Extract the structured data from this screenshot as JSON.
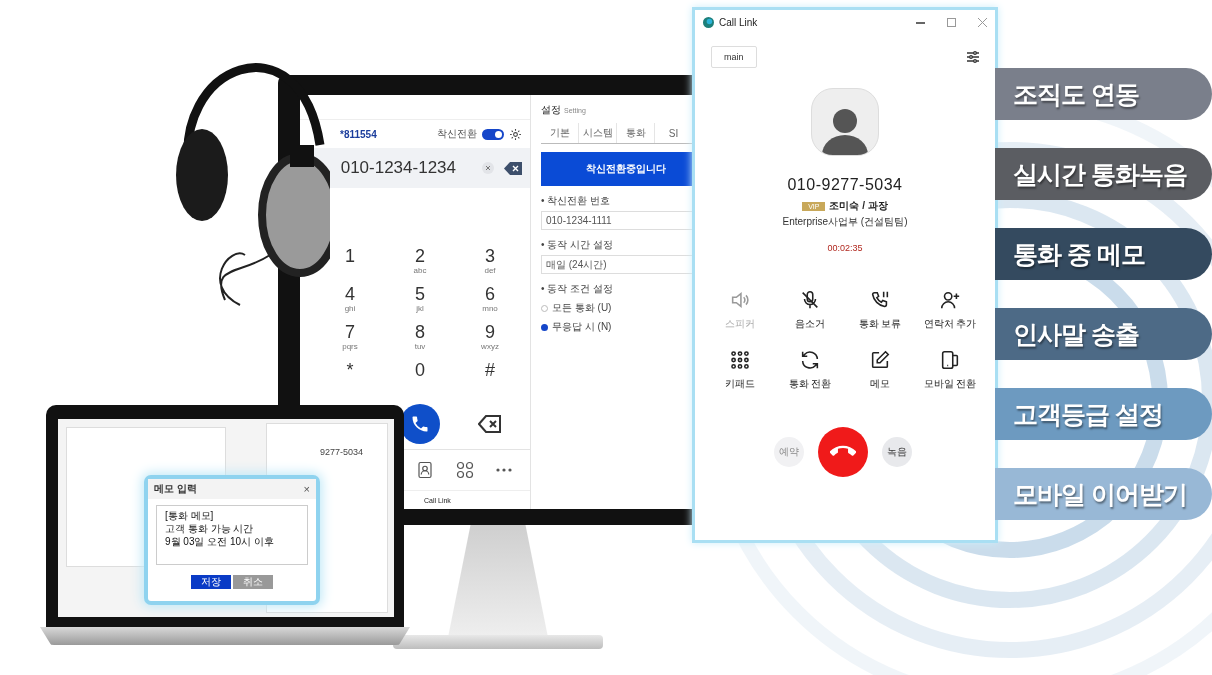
{
  "desktop_app": {
    "dialer": {
      "extension": "*811554",
      "forward_label": "착신전환",
      "forward_on": true,
      "number": "010-1234-1234",
      "keys": [
        {
          "digit": "1"
        },
        {
          "digit": "2",
          "letters": "abc"
        },
        {
          "digit": "3",
          "letters": "def"
        },
        {
          "digit": "4",
          "letters": "ghi"
        },
        {
          "digit": "5",
          "letters": "jkl"
        },
        {
          "digit": "6",
          "letters": "mno"
        },
        {
          "digit": "7",
          "letters": "pqrs"
        },
        {
          "digit": "8",
          "letters": "tuv"
        },
        {
          "digit": "9",
          "letters": "wxyz"
        },
        {
          "digit": "*"
        },
        {
          "digit": "0"
        },
        {
          "digit": "#"
        }
      ],
      "footer": "Call Link"
    },
    "settings": {
      "title": "설정",
      "subtitle": "Setting",
      "tabs": [
        {
          "label": "기본",
          "selected": false
        },
        {
          "label": "시스템",
          "selected": false
        },
        {
          "label": "통화",
          "selected": false
        },
        {
          "label": "SI",
          "selected": false
        }
      ],
      "banner": "착신전환중입니다",
      "fields": [
        {
          "label": "• 착신전환 번호",
          "value": "010-1234-1111"
        },
        {
          "label": "• 동작 시간 설정",
          "value": "매일 (24시간)"
        }
      ],
      "condition_label": "• 동작 조건 설정",
      "options": [
        {
          "label": "모든 통화 (U)",
          "selected": false
        },
        {
          "label": "무응답 시 (N)",
          "selected": true
        }
      ]
    }
  },
  "call_window": {
    "title": "Call Link",
    "line": "main",
    "number": "010-9277-5034",
    "grade": "VIP",
    "name": "조미숙 / 과장",
    "department": "Enterprise사업부 (건설팀팀)",
    "duration": "00:02:35",
    "actions": [
      {
        "label": "스피커",
        "disabled": true
      },
      {
        "label": "음소거",
        "disabled": false
      },
      {
        "label": "통화 보류",
        "disabled": false
      },
      {
        "label": "연락처 추가",
        "disabled": false
      },
      {
        "label": "키패드",
        "disabled": false
      },
      {
        "label": "통화 전환",
        "disabled": false
      },
      {
        "label": "메모",
        "disabled": false
      },
      {
        "label": "모바일 전환",
        "disabled": false
      }
    ],
    "reserve": "예약",
    "record": "녹음"
  },
  "laptop": {
    "background_number": "9277-5034",
    "memo_dialog": {
      "title": "메모 입력",
      "close": "×",
      "text": "[통화 메모]\n고객 통화 가능 시간\n9월 03일 오전 10시 이후",
      "buttons": [
        {
          "label": "저장",
          "kind": "primary"
        },
        {
          "label": "취소",
          "kind": "secondary"
        }
      ]
    }
  },
  "features": [
    {
      "label": "조직도 연동",
      "color": "#7a7f8b"
    },
    {
      "label": "실시간 통화녹음",
      "color": "#5b5d62"
    },
    {
      "label": "통화 중 메모",
      "color": "#344a5f"
    },
    {
      "label": "인사말 송출",
      "color": "#4d6a86"
    },
    {
      "label": "고객등급 설정",
      "color": "#6d9ac0"
    },
    {
      "label": "모바일 이어받기",
      "color": "#98b8d6"
    }
  ]
}
